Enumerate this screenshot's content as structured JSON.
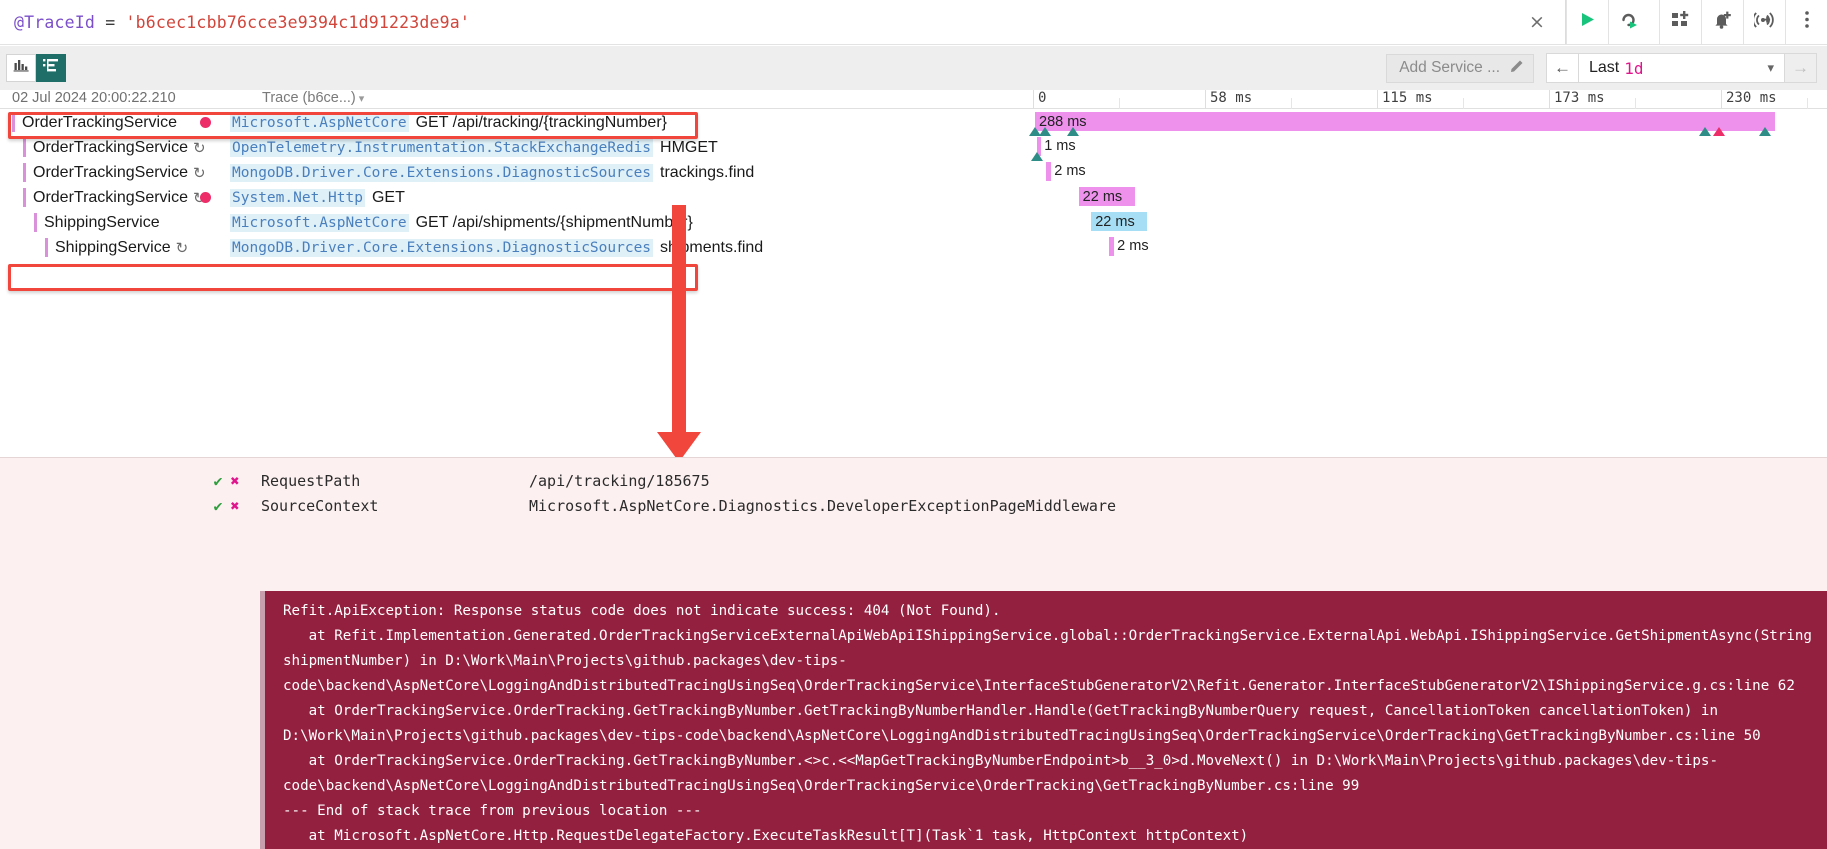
{
  "query_bar": {
    "variable": "@TraceId",
    "operator": "=",
    "value": "'b6cec1cbb76cce3e9394c1d91223de9a'",
    "clear_label": "×",
    "icons": {
      "run": "play-icon",
      "replay": "replay-icon",
      "dashboard": "add-to-dashboard-icon",
      "alert": "add-alert-icon",
      "signal": "add-signal-icon",
      "more": "more-options-icon"
    }
  },
  "toolbar": {
    "view_chart_label": "chart-view",
    "view_trace_label": "trace-view",
    "add_service_label": "Add Service ...",
    "edit_icon": "pencil-icon",
    "prev_label": "←",
    "range_prefix": "Last",
    "range_value": "1d",
    "chevron": "▾",
    "next_label": "→"
  },
  "trace": {
    "header_timestamp": "02 Jul 2024 20:00:22.210",
    "header_trace": "Trace (b6ce...)",
    "header_caret": "▾",
    "rows": [
      {
        "service": "OrderTrackingService",
        "indent": 0,
        "retry": false,
        "error": true,
        "source": "Microsoft.AspNetCore",
        "operation": "GET /api/tracking/{trackingNumber}",
        "highlight": true
      },
      {
        "service": "OrderTrackingService",
        "indent": 1,
        "retry": true,
        "error": false,
        "source": "OpenTelemetry.Instrumentation.StackExchangeRedis",
        "operation": "HMGET",
        "highlight": false
      },
      {
        "service": "OrderTrackingService",
        "indent": 1,
        "retry": true,
        "error": false,
        "source": "MongoDB.Driver.Core.Extensions.DiagnosticSources",
        "operation": "trackings.find",
        "highlight": false
      },
      {
        "service": "OrderTrackingService",
        "indent": 1,
        "retry": true,
        "error": true,
        "source": "System.Net.Http",
        "operation": "GET",
        "highlight": true
      },
      {
        "service": "ShippingService",
        "indent": 2,
        "retry": false,
        "error": false,
        "source": "Microsoft.AspNetCore",
        "operation": "GET /api/shipments/{shipmentNumber}",
        "highlight": false
      },
      {
        "service": "ShippingService",
        "indent": 3,
        "retry": true,
        "error": false,
        "source": "MongoDB.Driver.Core.Extensions.DiagnosticSources",
        "operation": "shipments.find",
        "highlight": false
      }
    ]
  },
  "timeline": {
    "ticks": [
      "0",
      "58 ms",
      "115 ms",
      "173 ms",
      "230 ms"
    ],
    "bars": [
      {
        "label": "288 ms",
        "color": "pink",
        "left_pct": 0.0,
        "width_pct": 100.0,
        "inside": true
      },
      {
        "label": "1 ms",
        "color": "pink",
        "left_pct": 0.3,
        "width_pct": 0.45,
        "inside": false
      },
      {
        "label": "2 ms",
        "color": "pink",
        "left_pct": 1.5,
        "width_pct": 0.7,
        "inside": false
      },
      {
        "label": "22 ms",
        "color": "pink",
        "left_pct": 5.9,
        "width_pct": 7.6,
        "inside": true
      },
      {
        "label": "22 ms",
        "color": "blue",
        "left_pct": 7.6,
        "width_pct": 7.6,
        "inside": true
      },
      {
        "label": "2 ms",
        "color": "pink",
        "left_pct": 10.0,
        "width_pct": 0.7,
        "inside": false
      }
    ]
  },
  "detail": {
    "properties": [
      {
        "check": "✔",
        "cross": "✖",
        "name": "RequestPath",
        "value": "/api/tracking/185675"
      },
      {
        "check": "✔",
        "cross": "✖",
        "name": "SourceContext",
        "value": "Microsoft.AspNetCore.Diagnostics.DeveloperExceptionPageMiddleware"
      }
    ],
    "exception": "Refit.ApiException: Response status code does not indicate success: 404 (Not Found).\n   at Refit.Implementation.Generated.OrderTrackingServiceExternalApiWebApiIShippingService.global::OrderTrackingService.ExternalApi.WebApi.IShippingService.GetShipmentAsync(String shipmentNumber) in D:\\Work\\Main\\Projects\\github.packages\\dev-tips-code\\backend\\AspNetCore\\LoggingAndDistributedTracingUsingSeq\\OrderTrackingService\\InterfaceStubGeneratorV2\\Refit.Generator.InterfaceStubGeneratorV2\\IShippingService.g.cs:line 62\n   at OrderTrackingService.OrderTracking.GetTrackingByNumber.GetTrackingByNumberHandler.Handle(GetTrackingByNumberQuery request, CancellationToken cancellationToken) in D:\\Work\\Main\\Projects\\github.packages\\dev-tips-code\\backend\\AspNetCore\\LoggingAndDistributedTracingUsingSeq\\OrderTrackingService\\OrderTracking\\GetTrackingByNumber.cs:line 50\n   at OrderTrackingService.OrderTracking.GetTrackingByNumber.<>c.<<MapGetTrackingByNumberEndpoint>b__3_0>d.MoveNext() in D:\\Work\\Main\\Projects\\github.packages\\dev-tips-code\\backend\\AspNetCore\\LoggingAndDistributedTracingUsingSeq\\OrderTrackingService\\OrderTracking\\GetTrackingByNumber.cs:line 99\n--- End of stack trace from previous location ---\n   at Microsoft.AspNetCore.Http.RequestDelegateFactory.ExecuteTaskResult[T](Task`1 task, HttpContext httpContext)"
  },
  "colors": {
    "accent_teal": "#1f6f68",
    "error_red": "#f0463c",
    "bar_pink": "#ed91ec",
    "bar_blue": "#a6dff5",
    "exception_bg": "#93203f",
    "magenta": "#e0148c"
  }
}
